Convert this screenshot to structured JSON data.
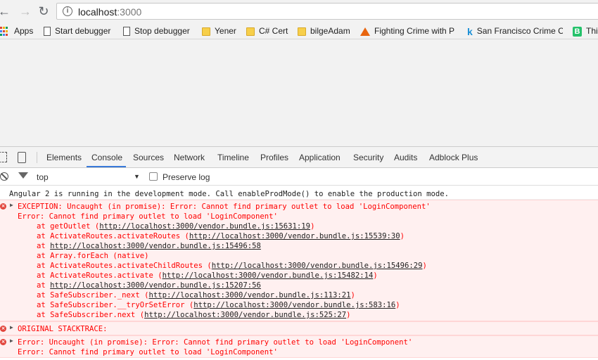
{
  "browser": {
    "url_host": "localhost",
    "url_port": ":3000",
    "bookmarks": [
      {
        "label": "Apps",
        "icon": "apps-grid-icon"
      },
      {
        "label": "Start debugger",
        "icon": "page-icon"
      },
      {
        "label": "Stop debugger",
        "icon": "page-icon"
      },
      {
        "label": "Yener",
        "icon": "folder-icon"
      },
      {
        "label": "C# Cert",
        "icon": "folder-icon"
      },
      {
        "label": "bilgeAdam",
        "icon": "folder-icon"
      },
      {
        "label": "Fighting Crime with P",
        "icon": "matlab-icon"
      },
      {
        "label": "San Francisco Crime C",
        "icon": "kaggle-icon"
      },
      {
        "label": "Thi",
        "icon": "b-icon"
      }
    ]
  },
  "devtools": {
    "tabs": [
      "Elements",
      "Console",
      "Sources",
      "Network",
      "Timeline",
      "Profiles",
      "Application",
      "Security",
      "Audits",
      "Adblock Plus"
    ],
    "active_tab": "Console",
    "context": "top",
    "preserve_log": "Preserve log"
  },
  "console": {
    "info": "Angular 2 is running in the development mode. Call enableProdMode() to enable the production mode.",
    "exception_header": "EXCEPTION: Uncaught (in promise): Error: Cannot find primary outlet to load 'LoginComponent'",
    "error_line": "Error: Cannot find primary outlet to load 'LoginComponent'",
    "stack": [
      {
        "prefix": "at getOutlet (",
        "link": "http://localhost:3000/vendor.bundle.js:15631:19",
        "suffix": ")"
      },
      {
        "prefix": "at ActivateRoutes.activateRoutes (",
        "link": "http://localhost:3000/vendor.bundle.js:15539:30",
        "suffix": ")"
      },
      {
        "prefix": "at ",
        "link": "http://localhost:3000/vendor.bundle.js:15496:58",
        "suffix": ""
      },
      {
        "prefix": "at Array.forEach (native)",
        "link": "",
        "suffix": ""
      },
      {
        "prefix": "at ActivateRoutes.activateChildRoutes (",
        "link": "http://localhost:3000/vendor.bundle.js:15496:29",
        "suffix": ")"
      },
      {
        "prefix": "at ActivateRoutes.activate (",
        "link": "http://localhost:3000/vendor.bundle.js:15482:14",
        "suffix": ")"
      },
      {
        "prefix": "at ",
        "link": "http://localhost:3000/vendor.bundle.js:15207:56",
        "suffix": ""
      },
      {
        "prefix": "at SafeSubscriber._next (",
        "link": "http://localhost:3000/vendor.bundle.js:113:21",
        "suffix": ")"
      },
      {
        "prefix": "at SafeSubscriber.__tryOrSetError (",
        "link": "http://localhost:3000/vendor.bundle.js:583:16",
        "suffix": ")"
      },
      {
        "prefix": "at SafeSubscriber.next (",
        "link": "http://localhost:3000/vendor.bundle.js:525:27",
        "suffix": ")"
      }
    ],
    "original_stacktrace": "ORIGINAL STACKTRACE:",
    "error2_header": "Error: Uncaught (in promise): Error: Cannot find primary outlet to load 'LoginComponent'",
    "error2_line": "Error: Cannot find primary outlet to load 'LoginComponent'"
  }
}
